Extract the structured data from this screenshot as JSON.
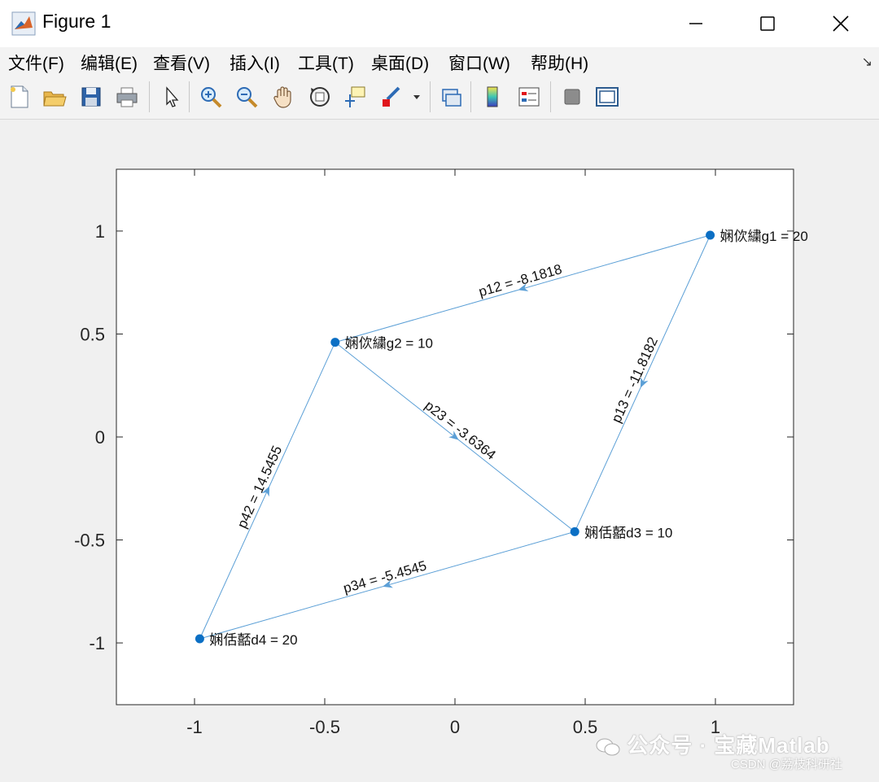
{
  "window": {
    "title": "Figure 1"
  },
  "menu": {
    "items": [
      "文件(F)",
      "编辑(E)",
      "查看(V)",
      "插入(I)",
      "工具(T)",
      "桌面(D)",
      "窗口(W)",
      "帮助(H)"
    ]
  },
  "toolbar": {
    "icons": [
      "new-figure-icon",
      "open-file-icon",
      "save-icon",
      "print-icon",
      "select-arrow-icon",
      "zoom-in-icon",
      "zoom-out-icon",
      "pan-hand-icon",
      "rotate-3d-icon",
      "data-cursor-icon",
      "brush-icon",
      "link-plot-icon",
      "colorbar-icon",
      "legend-icon",
      "hide-plot-tools-icon",
      "show-plot-tools-icon"
    ]
  },
  "chart_data": {
    "type": "scatter",
    "xlim": [
      -1.3,
      1.3
    ],
    "ylim": [
      -1.3,
      1.3
    ],
    "xticks": [
      "-1",
      "-0.5",
      "0",
      "0.5",
      "1"
    ],
    "yticks": [
      "1",
      "0.5",
      "0",
      "-0.5",
      "-1"
    ],
    "grid": false,
    "nodes": [
      {
        "id": "g1",
        "x": 0.98,
        "y": 0.98,
        "label": "娴佽繍g1 = 20"
      },
      {
        "id": "g2",
        "x": -0.46,
        "y": 0.46,
        "label": "娴佽繍g2 =  10"
      },
      {
        "id": "d3",
        "x": 0.46,
        "y": -0.46,
        "label": "娴佸嚭d3 = 10"
      },
      {
        "id": "d4",
        "x": -0.98,
        "y": -0.98,
        "label": "娴佸嚭d4 = 20"
      }
    ],
    "edges": [
      {
        "from": "g1",
        "to": "g2",
        "label": "p12 = -8.1818"
      },
      {
        "from": "g1",
        "to": "d3",
        "label": "p13 =  -11.8182"
      },
      {
        "from": "g2",
        "to": "d3",
        "label": "p23 = -3.6364"
      },
      {
        "from": "d3",
        "to": "d4",
        "label": "p34 = -5.4545"
      },
      {
        "from": "d4",
        "to": "g2",
        "label": "p42 = 14.5455"
      }
    ],
    "colors": {
      "node": "#0b6fc4",
      "edge": "#5b9fd6",
      "axis": "#262626"
    }
  },
  "watermark": {
    "main": "公众号 · 宝藏Matlab",
    "sub": "CSDN @荔枝科研社"
  }
}
